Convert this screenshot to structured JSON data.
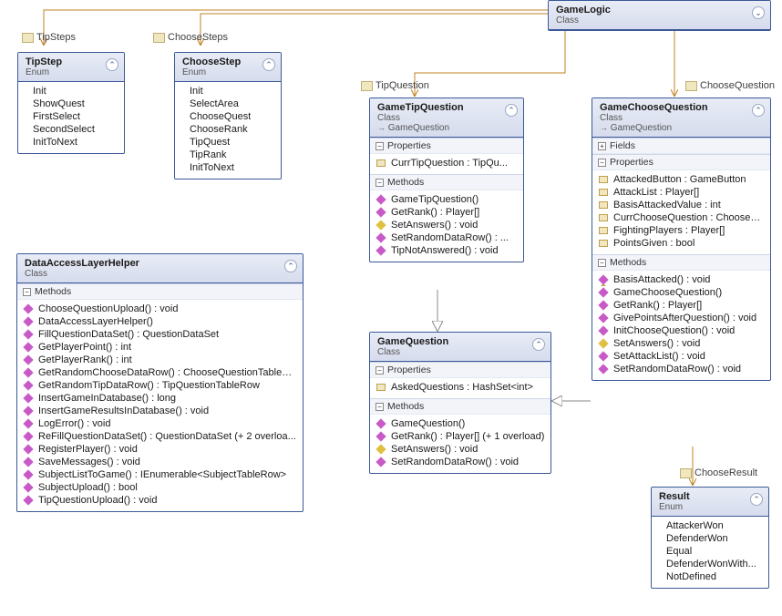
{
  "gamelogic": {
    "name": "GameLogic",
    "kind": "Class"
  },
  "tipstep": {
    "name": "TipStep",
    "kind": "Enum",
    "members": [
      "Init",
      "ShowQuest",
      "FirstSelect",
      "SecondSelect",
      "InitToNext"
    ]
  },
  "choosestep": {
    "name": "ChooseStep",
    "kind": "Enum",
    "members": [
      "Init",
      "SelectArea",
      "ChooseQuest",
      "ChooseRank",
      "TipQuest",
      "TipRank",
      "InitToNext"
    ]
  },
  "dalh": {
    "name": "DataAccessLayerHelper",
    "kind": "Class",
    "methods": [
      {
        "name": "ChooseQuestionUpload() : void",
        "vis": "public"
      },
      {
        "name": "DataAccessLayerHelper()",
        "vis": "public"
      },
      {
        "name": "FillQuestionDataSet() : QuestionDataSet",
        "vis": "public"
      },
      {
        "name": "GetPlayerPoint() : int",
        "vis": "public"
      },
      {
        "name": "GetPlayerRank() : int",
        "vis": "public"
      },
      {
        "name": "GetRandomChooseDataRow() : ChooseQuestionTableR...",
        "vis": "public"
      },
      {
        "name": "GetRandomTipDataRow() : TipQuestionTableRow",
        "vis": "public"
      },
      {
        "name": "InsertGameInDatabase() : long",
        "vis": "public"
      },
      {
        "name": "InsertGameResultsInDatabase() : void",
        "vis": "public"
      },
      {
        "name": "LogError() : void",
        "vis": "public"
      },
      {
        "name": "ReFillQuestionDataSet() : QuestionDataSet (+ 2 overloa...",
        "vis": "public"
      },
      {
        "name": "RegisterPlayer() : void",
        "vis": "public"
      },
      {
        "name": "SaveMessages() : void",
        "vis": "public"
      },
      {
        "name": "SubjectListToGame() : IEnumerable<SubjectTableRow>",
        "vis": "public"
      },
      {
        "name": "SubjectUpload() : bool",
        "vis": "public"
      },
      {
        "name": "TipQuestionUpload() : void",
        "vis": "public"
      }
    ]
  },
  "gametip": {
    "name": "GameTipQuestion",
    "kind": "Class",
    "base": "GameQuestion",
    "properties": [
      {
        "name": "CurrTipQuestion : TipQu..."
      }
    ],
    "methods": [
      {
        "name": "GameTipQuestion()",
        "vis": "public"
      },
      {
        "name": "GetRank() : Player[]",
        "vis": "public"
      },
      {
        "name": "SetAnswers() : void",
        "vis": "protected"
      },
      {
        "name": "SetRandomDataRow() : ...",
        "vis": "public"
      },
      {
        "name": "TipNotAnswered() : void",
        "vis": "public"
      }
    ]
  },
  "gamechoose": {
    "name": "GameChooseQuestion",
    "kind": "Class",
    "base": "GameQuestion",
    "fields_label": "Fields",
    "properties": [
      {
        "name": "AttackedButton : GameButton"
      },
      {
        "name": "AttackList : Player[]"
      },
      {
        "name": "BasisAttackedValue : int"
      },
      {
        "name": "CurrChooseQuestion : ChooseQu..."
      },
      {
        "name": "FightingPlayers : Player[]"
      },
      {
        "name": "PointsGiven : bool"
      }
    ],
    "methods": [
      {
        "name": "BasisAttacked() : void",
        "vis": "private"
      },
      {
        "name": "GameChooseQuestion()",
        "vis": "public"
      },
      {
        "name": "GetRank() : Player[]",
        "vis": "public"
      },
      {
        "name": "GivePointsAfterQuestion() : void",
        "vis": "public"
      },
      {
        "name": "InitChooseQuestion() : void",
        "vis": "public"
      },
      {
        "name": "SetAnswers() : void",
        "vis": "protected"
      },
      {
        "name": "SetAttackList() : void",
        "vis": "public"
      },
      {
        "name": "SetRandomDataRow() : void",
        "vis": "public"
      }
    ]
  },
  "gamequestion": {
    "name": "GameQuestion",
    "kind": "Class",
    "properties": [
      {
        "name": "AskedQuestions : HashSet<int>"
      }
    ],
    "methods": [
      {
        "name": "GameQuestion()",
        "vis": "public"
      },
      {
        "name": "GetRank() : Player[] (+ 1 overload)",
        "vis": "public"
      },
      {
        "name": "SetAnswers() : void",
        "vis": "protected"
      },
      {
        "name": "SetRandomDataRow() : void",
        "vis": "public"
      }
    ]
  },
  "result": {
    "name": "Result",
    "kind": "Enum",
    "members": [
      "AttackerWon",
      "DefenderWon",
      "Equal",
      "DefenderWonWith...",
      "NotDefined"
    ]
  },
  "labels": {
    "tipsteps": "TipSteps",
    "choosesteps": "ChooseSteps",
    "tipquestion": "TipQuestion",
    "choosequestion": "ChooseQuestion",
    "chooseresult": "ChooseResult",
    "properties": "Properties",
    "methods": "Methods",
    "fields": "Fields"
  },
  "chart_data": {
    "type": "class-diagram",
    "classes": [
      {
        "name": "GameLogic",
        "kind": "Class"
      },
      {
        "name": "TipStep",
        "kind": "Enum",
        "members": [
          "Init",
          "ShowQuest",
          "FirstSelect",
          "SecondSelect",
          "InitToNext"
        ]
      },
      {
        "name": "ChooseStep",
        "kind": "Enum",
        "members": [
          "Init",
          "SelectArea",
          "ChooseQuest",
          "ChooseRank",
          "TipQuest",
          "TipRank",
          "InitToNext"
        ]
      },
      {
        "name": "DataAccessLayerHelper",
        "kind": "Class"
      },
      {
        "name": "GameTipQuestion",
        "kind": "Class",
        "base": "GameQuestion"
      },
      {
        "name": "GameChooseQuestion",
        "kind": "Class",
        "base": "GameQuestion"
      },
      {
        "name": "GameQuestion",
        "kind": "Class"
      },
      {
        "name": "Result",
        "kind": "Enum",
        "members": [
          "AttackerWon",
          "DefenderWon",
          "Equal",
          "DefenderWonWith...",
          "NotDefined"
        ]
      }
    ],
    "associations": [
      {
        "from": "GameLogic",
        "to": "TipStep",
        "label": "TipSteps"
      },
      {
        "from": "GameLogic",
        "to": "ChooseStep",
        "label": "ChooseSteps"
      },
      {
        "from": "GameLogic",
        "to": "GameTipQuestion",
        "label": "TipQuestion"
      },
      {
        "from": "GameLogic",
        "to": "GameChooseQuestion",
        "label": "ChooseQuestion"
      },
      {
        "from": "GameChooseQuestion",
        "to": "Result",
        "label": "ChooseResult"
      }
    ],
    "inheritance": [
      {
        "child": "GameTipQuestion",
        "parent": "GameQuestion"
      },
      {
        "child": "GameChooseQuestion",
        "parent": "GameQuestion"
      }
    ]
  }
}
